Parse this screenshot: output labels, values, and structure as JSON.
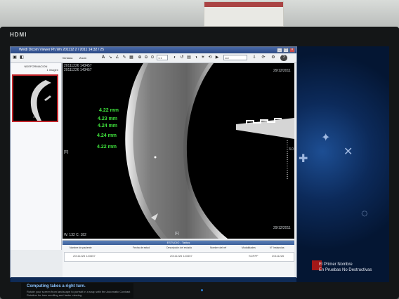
{
  "monitor": {
    "brand": "HDMI"
  },
  "window": {
    "title": "Weidi Dicom Viewer  Ph.Wn 201112 2 / 2011 14:32 / 25",
    "controls": [
      "_",
      "□",
      "×"
    ]
  },
  "toolbar": {
    "items": [
      "Ventana",
      "Zoom"
    ],
    "zoom_value": "1:1",
    "preset_value": "Lut"
  },
  "left_panel": {
    "header": "NDEFORMACION",
    "subheader": "1 imagen",
    "thumbnail_label": "1"
  },
  "viewer": {
    "overlay_top_left": "20111226 143457",
    "overlay_top_date": "29/12/2011",
    "overlay_left_marker": "[R]",
    "overlay_bottom_marker": "[F]",
    "overlay_bottom_left": "W: 132 C: 182",
    "overlay_bottom_right": "29/12/2011",
    "measurements": [
      "4.22 mm",
      "4.23 mm",
      "4.24 mm",
      "4.24 mm",
      "4.22 mm"
    ],
    "ruler_label": "3.0"
  },
  "bottom_panel": {
    "title": "ESTUDIO - Tablas",
    "headers": [
      "Nombre de paciente",
      "Fecha de estud",
      "Descripción del estudio",
      "Nombre del ref",
      "Modalidades",
      "N° Instancias"
    ],
    "row": [
      "20111226 143457",
      "",
      "20111226 143457",
      "",
      "SCRPF",
      "20111226"
    ]
  },
  "desktop": {
    "line1": "El Primer Nombre",
    "line2": "En Pruebas No Destructivas"
  },
  "promo": {
    "title": "Computing takes a right turn.",
    "body": "Rotate your screen from landscape to portrait in a snap with the Automatic Contrast Rotation for less scrolling and faster viewing."
  }
}
